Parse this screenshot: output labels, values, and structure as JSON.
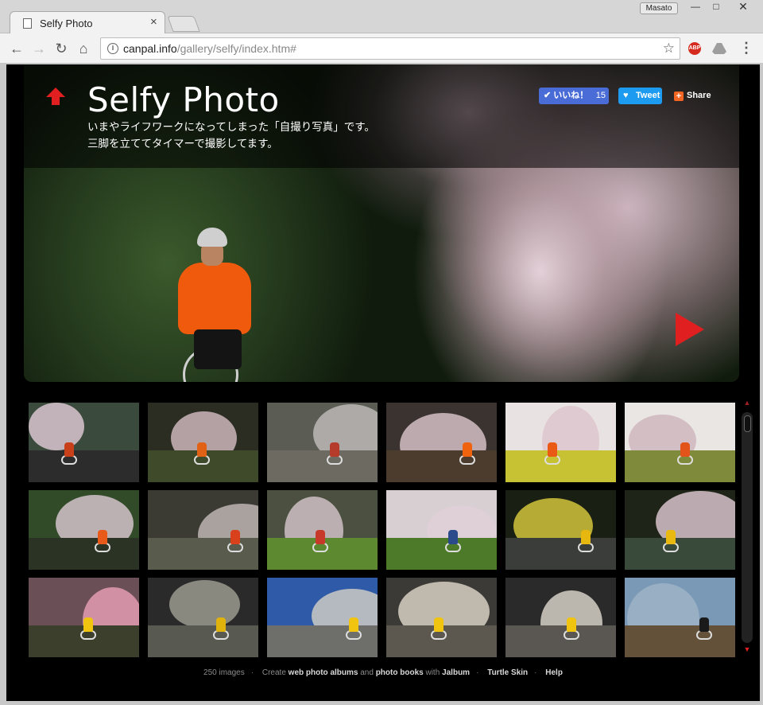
{
  "browser": {
    "tab_title": "Selfy Photo",
    "user_name": "Masato",
    "url_domain": "canpal.info",
    "url_path": "/gallery/selfy/index.htm#",
    "minimize": "—",
    "maximize": "□",
    "close": "✕"
  },
  "hero": {
    "title": "Selfy Photo",
    "description_line1": "いまやライフワークになってしまった「自撮り写真」です。",
    "description_line2": "三脚を立ててタイマーで撮影してます。"
  },
  "share": {
    "like_label": "✔ いいね！",
    "like_count": "15",
    "tweet_label": "Tweet",
    "share_label": "Share"
  },
  "thumbnails": [
    {
      "sky": "#3a4a3c",
      "blossom": "#d9c6cf",
      "ground": "#2c2c2c",
      "fig": "#c8401a"
    },
    {
      "sky": "#2b2c22",
      "blossom": "#cbb6bb",
      "ground": "#3f4a2a",
      "fig": "#e26215"
    },
    {
      "sky": "#5b5d55",
      "blossom": "#bcb7b6",
      "ground": "#6d6b61",
      "fig": "#b53c2b"
    },
    {
      "sky": "#3a3330",
      "blossom": "#d4c0c6",
      "ground": "#4b3c2e",
      "fig": "#f0630e"
    },
    {
      "sky": "#e8e2e2",
      "blossom": "#dec6cf",
      "ground": "#c6c233",
      "fig": "#ea5a14"
    },
    {
      "sky": "#eae6e4",
      "blossom": "#cfb6be",
      "ground": "#7f8b3a",
      "fig": "#e2541a"
    },
    {
      "sky": "#314a28",
      "blossom": "#d4c3ca",
      "ground": "#2b3324",
      "fig": "#e75a1a"
    },
    {
      "sky": "#3c3b33",
      "blossom": "#bdb5b3",
      "ground": "#595b4c",
      "fig": "#d9411c"
    },
    {
      "sky": "#4b5040",
      "blossom": "#cfc0c5",
      "ground": "#5d8a30",
      "fig": "#c73a2a"
    },
    {
      "sky": "#d8cfd3",
      "blossom": "#e1cfd6",
      "ground": "#4d7a28",
      "fig": "#2b4a8c"
    },
    {
      "sky": "#1a1f14",
      "blossom": "#d2c43a",
      "ground": "#3b3d3b",
      "fig": "#e5b70f"
    },
    {
      "sky": "#1e2418",
      "blossom": "#d7c3cb",
      "ground": "#3a4a3a",
      "fig": "#e9b912"
    },
    {
      "sky": "#6b4f56",
      "blossom": "#e49bb2",
      "ground": "#3c3f2c",
      "fig": "#f1c40f"
    },
    {
      "sky": "#2a2a2a",
      "blossom": "#9a9a8e",
      "ground": "#585a52",
      "fig": "#e0b20c"
    },
    {
      "sky": "#2f5aa7",
      "blossom": "#cbcbc3",
      "ground": "#6e6e6a",
      "fig": "#f1c40f"
    },
    {
      "sky": "#3b3a36",
      "blossom": "#d8d0c2",
      "ground": "#5c5850",
      "fig": "#f1c40f"
    },
    {
      "sky": "#2a2a2a",
      "blossom": "#d5d0c5",
      "ground": "#5a5752",
      "fig": "#f1c40f"
    },
    {
      "sky": "#7a99b6",
      "blossom": "#9db3c7",
      "ground": "#63513a",
      "fig": "#1a1a1a"
    }
  ],
  "footer": {
    "count": "250 images",
    "create": "Create",
    "web_albums": "web photo albums",
    "and": "and",
    "photo_books": "photo books",
    "with": "with",
    "jalbum": "Jalbum",
    "skin": "Turtle Skin",
    "help": "Help"
  },
  "colors": {
    "accent_red": "#e02020",
    "facebook": "#4a6cd6",
    "twitter": "#1d9bf0"
  }
}
